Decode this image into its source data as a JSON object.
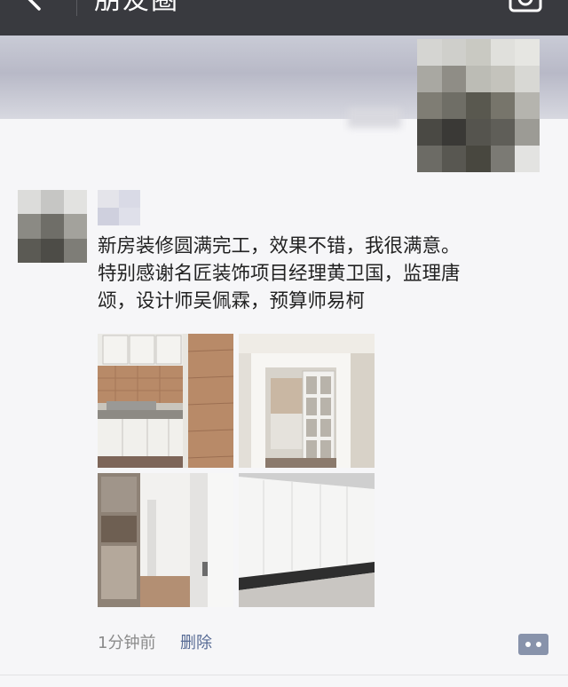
{
  "header": {
    "title": "朋友圈"
  },
  "post": {
    "text_lines": [
      "新房装修圆满完工，效果不错，我很满意。",
      "特别感谢名匠装饰项目经理黄卫国，监理唐",
      "颂，设计师吴佩霖，预算师易柯"
    ],
    "time": "1分钟前",
    "delete_label": "删除"
  },
  "icons": {
    "back": "back-arrow-icon",
    "camera": "camera-icon",
    "comment": "comment-icon"
  },
  "colors": {
    "navbar": "#393a3f",
    "link": "#576b95",
    "meta": "#8a8a8a"
  }
}
